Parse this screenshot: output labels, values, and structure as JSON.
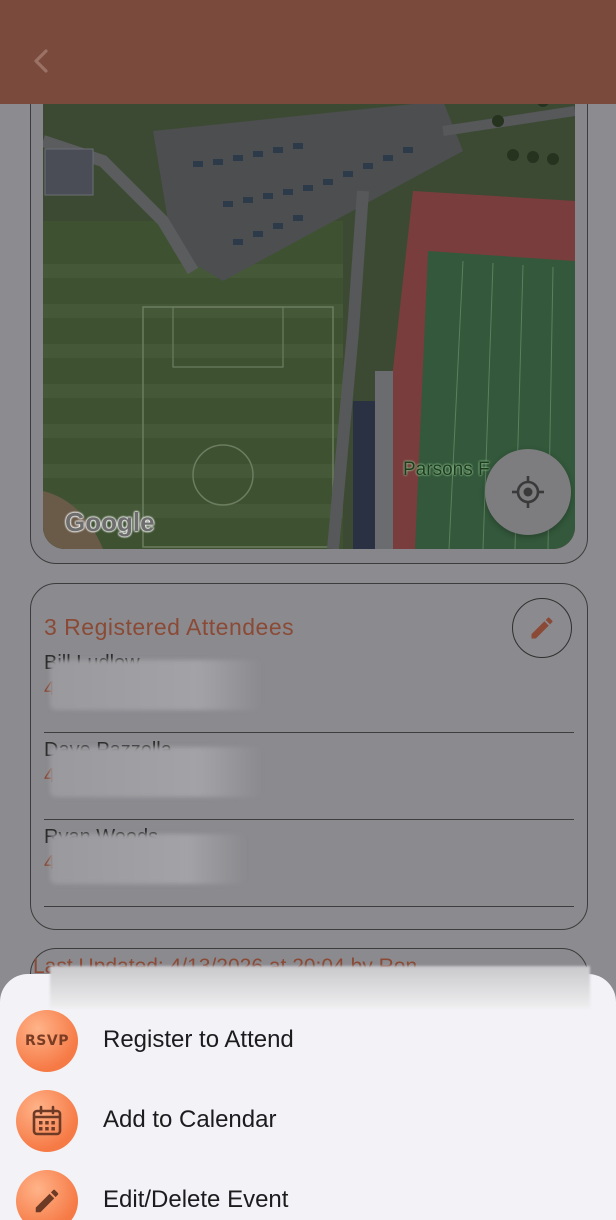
{
  "header": {
    "back_icon": "chevron-left-icon"
  },
  "map": {
    "logo_text": "Google",
    "place_label": "Parsons F",
    "locate_icon": "crosshair-icon"
  },
  "attendees": {
    "title": "3 Registered Attendees",
    "edit_icon": "pencil-icon",
    "items": [
      {
        "name": "Bill Ludlow",
        "sub": "4"
      },
      {
        "name": "Dave Pazzolla",
        "sub": "4"
      },
      {
        "name": "Ryan Woods",
        "sub": "4"
      }
    ]
  },
  "last_updated": "Last Updated: 4/13/2026 at 20:04 by Ron",
  "sheet": {
    "items": [
      {
        "label": "Register to Attend",
        "icon": "rsvp-icon",
        "icon_text": "RSVP"
      },
      {
        "label": "Add to Calendar",
        "icon": "calendar-icon"
      },
      {
        "label": "Edit/Delete Event",
        "icon": "pencil-icon"
      }
    ]
  },
  "colors": {
    "accent": "#f67a46",
    "header": "#7a4a3c",
    "sheet_bg": "#f2f2f7"
  }
}
